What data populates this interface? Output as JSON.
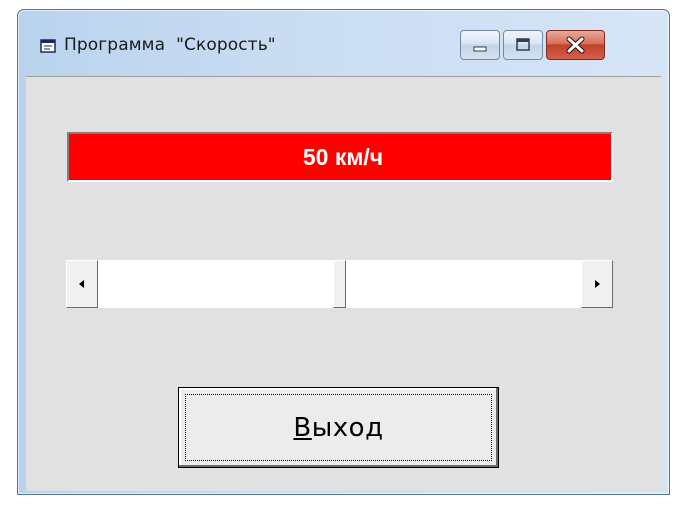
{
  "window": {
    "title": "Программа  \"Скорость\"",
    "icon": "form-icon"
  },
  "title_buttons": {
    "minimize_icon": "minimize-icon",
    "maximize_icon": "maximize-icon",
    "close_icon": "close-icon"
  },
  "speed_display": {
    "text": "50 км/ч",
    "background_color": "#ff0000",
    "text_color": "#ffffff"
  },
  "speed_scrollbar": {
    "value_fraction": 0.5,
    "left_arrow_icon": "arrow-left-icon",
    "right_arrow_icon": "arrow-right-icon"
  },
  "exit_button": {
    "mnemonic": "В",
    "rest": "ыход"
  }
}
